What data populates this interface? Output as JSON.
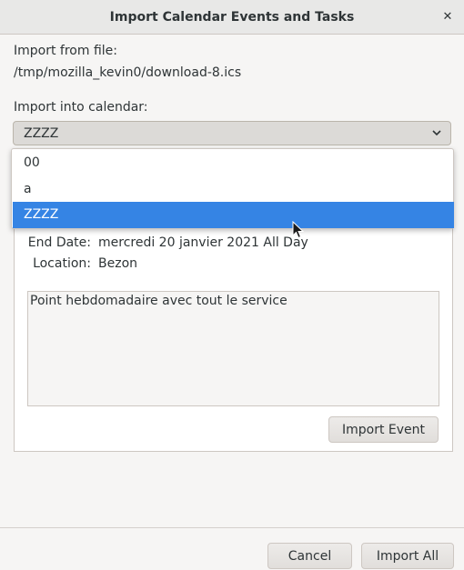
{
  "window": {
    "title": "Import Calendar Events and Tasks",
    "close_glyph": "✕"
  },
  "import_from": {
    "label": "Import from file:",
    "path": "/tmp/mozilla_kevin0/download-8.ics"
  },
  "import_into": {
    "label": "Import into calendar:",
    "selected": "ZZZZ"
  },
  "dropdown": {
    "items": [
      {
        "label": "00",
        "selected": false
      },
      {
        "label": "a",
        "selected": false
      },
      {
        "label": "ZZZZ",
        "selected": true
      }
    ]
  },
  "event": {
    "end_date_label": "End Date:",
    "end_date_value": "mercredi 20 janvier 2021 All Day",
    "location_label": "Location:",
    "location_value": "Bezon",
    "description": "Point hebdomadaire avec tout le service",
    "import_event_button": "Import Event"
  },
  "footer": {
    "cancel": "Cancel",
    "import_all": "Import All"
  },
  "colors": {
    "selection": "#3584e4",
    "background": "#f6f5f4"
  },
  "icons": {
    "close": "close-icon",
    "combo_arrow": "chevron-down-icon",
    "pointer": "mouse-pointer-icon"
  }
}
